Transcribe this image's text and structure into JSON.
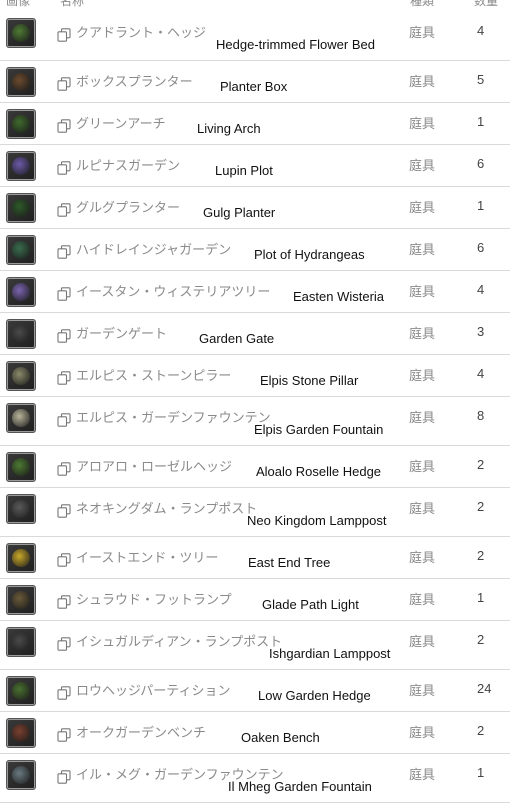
{
  "header": {
    "icon_col": "画像",
    "name_col": "名称",
    "category_col": "種類",
    "qty_col": "数量"
  },
  "items": [
    {
      "jp": "クアドラント・ヘッジ",
      "en": "Hedge-trimmed Flower Bed",
      "category": "庭具",
      "qty": "4",
      "thumb_color": "#4f7a34"
    },
    {
      "jp": "ボックスプランター",
      "en": "Planter Box",
      "category": "庭具",
      "qty": "5",
      "thumb_color": "#6b4a2e"
    },
    {
      "jp": "グリーンアーチ",
      "en": "Living Arch",
      "category": "庭具",
      "qty": "1",
      "thumb_color": "#3f6a2c"
    },
    {
      "jp": "ルピナスガーデン",
      "en": "Lupin Plot",
      "category": "庭具",
      "qty": "6",
      "thumb_color": "#6c5aa8"
    },
    {
      "jp": "グルグプランター",
      "en": "Gulg Planter",
      "category": "庭具",
      "qty": "1",
      "thumb_color": "#2f5a2a"
    },
    {
      "jp": "ハイドレインジャガーデン",
      "en": "Plot of Hydrangeas",
      "category": "庭具",
      "qty": "6",
      "thumb_color": "#3a6c4e"
    },
    {
      "jp": "イースタン・ウィステリアツリー",
      "en": "Easten Wisteria",
      "category": "庭具",
      "qty": "4",
      "thumb_color": "#7a64b0"
    },
    {
      "jp": "ガーデンゲート",
      "en": "Garden Gate",
      "category": "庭具",
      "qty": "3",
      "thumb_color": "#4a4a4a"
    },
    {
      "jp": "エルピス・ストーンピラー",
      "en": "Elpis Stone Pillar",
      "category": "庭具",
      "qty": "4",
      "thumb_color": "#8a8a6a"
    },
    {
      "jp": "エルピス・ガーデンファウンテン",
      "en": "Elpis Garden Fountain",
      "category": "庭具",
      "qty": "8",
      "thumb_color": "#b8b49a"
    },
    {
      "jp": "アロアロ・ローゼルヘッジ",
      "en": "Aloalo Roselle Hedge",
      "category": "庭具",
      "qty": "2",
      "thumb_color": "#4d7a32"
    },
    {
      "jp": "ネオキングダム・ランプポスト",
      "en": "Neo Kingdom Lamppost",
      "category": "庭具",
      "qty": "2",
      "thumb_color": "#5a5a5a"
    },
    {
      "jp": "イーストエンド・ツリー",
      "en": "East End Tree",
      "category": "庭具",
      "qty": "2",
      "thumb_color": "#c9a82a"
    },
    {
      "jp": "シュラウド・フットランプ",
      "en": "Glade Path Light",
      "category": "庭具",
      "qty": "1",
      "thumb_color": "#6a5a3a"
    },
    {
      "jp": "イシュガルディアン・ランプポスト",
      "en": "Ishgardian Lamppost",
      "category": "庭具",
      "qty": "2",
      "thumb_color": "#4a4a4a"
    },
    {
      "jp": "ロウヘッジパーティション",
      "en": "Low Garden Hedge",
      "category": "庭具",
      "qty": "24",
      "thumb_color": "#4a7030"
    },
    {
      "jp": "オークガーデンベンチ",
      "en": "Oaken Bench",
      "category": "庭具",
      "qty": "2",
      "thumb_color": "#7a4030"
    },
    {
      "jp": "イル・メグ・ガーデンファウンテン",
      "en": "Il Mheg Garden Fountain",
      "category": "庭具",
      "qty": "1",
      "thumb_color": "#6a7a80"
    }
  ]
}
